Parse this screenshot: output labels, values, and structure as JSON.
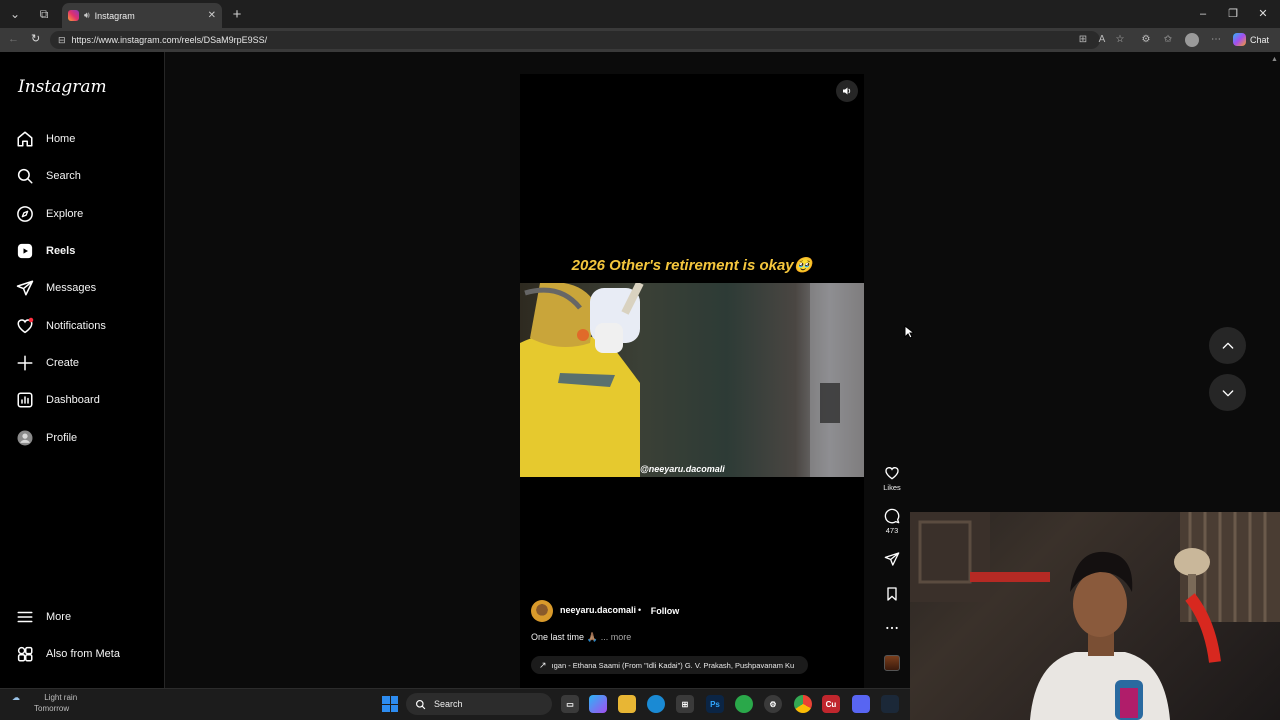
{
  "browser": {
    "tab_title": "Instagram",
    "url": "https://www.instagram.com/reels/DSaM9rpE9SS/",
    "chat_label": "Chat"
  },
  "sidebar": {
    "logo": "Instagram",
    "items": [
      {
        "label": "Home",
        "icon": "home-icon"
      },
      {
        "label": "Search",
        "icon": "search-icon"
      },
      {
        "label": "Explore",
        "icon": "compass-icon"
      },
      {
        "label": "Reels",
        "icon": "reels-icon"
      },
      {
        "label": "Messages",
        "icon": "messages-icon"
      },
      {
        "label": "Notifications",
        "icon": "heart-icon"
      },
      {
        "label": "Create",
        "icon": "plus-icon"
      },
      {
        "label": "Dashboard",
        "icon": "dashboard-icon"
      },
      {
        "label": "Profile",
        "icon": "avatar-icon"
      }
    ],
    "more_label": "More",
    "meta_label": "Also from Meta"
  },
  "reel": {
    "overlay_caption": "2026 Other's retirement is okay🥹",
    "watermark": "@neeyaru.dacomali",
    "username": "neeyaru.dacomali",
    "separator": "•",
    "follow_label": "Follow",
    "description": "One last time 🙏🏽",
    "more_label": "... more",
    "audio": "ıgan - Ethana Saami (From \"Idli Kadai\")  G. V. Prakash, Pushpavanam Ku",
    "likes_label": "Likes",
    "comments_count": "473"
  },
  "taskbar": {
    "weather": "Light rain",
    "weather_sub": "Tomorrow",
    "search_placeholder": "Search"
  },
  "colors": {
    "caption_yellow": "#f4c63d",
    "accent_blue": "#2d8cf0",
    "notification_dot": "#ff3040"
  }
}
